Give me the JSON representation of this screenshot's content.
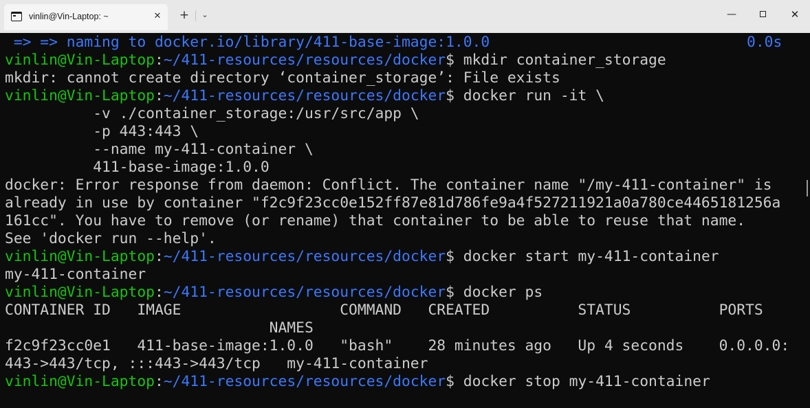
{
  "tab": {
    "title": "vinlin@Vin-Laptop: ~",
    "close_icon": "✕"
  },
  "tabbar": {
    "new_tab_icon": "+",
    "dropdown_icon": "⌄"
  },
  "window_controls": {
    "minimize": "—",
    "close": "✕"
  },
  "prompt": {
    "user": "vinlin@Vin-Laptop",
    "sep": ":",
    "path": "~/411-resources/resources/docker",
    "sign": "$ "
  },
  "terminal": {
    "build_line": {
      "text": " => => naming to docker.io/library/411-base-image:1.0.0",
      "time": "0.0s"
    },
    "cmd1": "mkdir container_storage",
    "out1": "mkdir: cannot create directory ‘container_storage’: File exists",
    "cmd2": "docker run -it \\",
    "cont": [
      "          -v ./container_storage:/usr/src/app \\",
      "          -p 443:443 \\",
      "          --name my-411-container \\",
      "          411-base-image:1.0.0"
    ],
    "error": [
      "docker: Error response from daemon: Conflict. The container name \"/my-411-container\" is",
      "already in use by container \"f2c9f23cc0e152ff87e81d786fe9a4f527211921a0a780ce4465181256a",
      "161cc\". You have to remove (or rename) that container to be able to reuse that name.",
      "See 'docker run --help'."
    ],
    "cmd3": "docker start my-411-container",
    "out3": "my-411-container",
    "cmd4": "docker ps",
    "ps_header": [
      "CONTAINER ID   IMAGE                  COMMAND   CREATED          STATUS          PORTS",
      "                              NAMES"
    ],
    "ps_row": [
      "f2c9f23cc0e1   411-base-image:1.0.0   \"bash\"    28 minutes ago   Up 4 seconds    0.0.0.0:",
      "443->443/tcp, :::443->443/tcp   my-411-container"
    ],
    "cmd5": "docker stop my-411-container"
  },
  "colors": {
    "background": "#0c0c0c",
    "foreground": "#cccccc",
    "prompt_user": "#16c60c",
    "prompt_path": "#3b78ff",
    "build_output": "#3b78ff"
  }
}
